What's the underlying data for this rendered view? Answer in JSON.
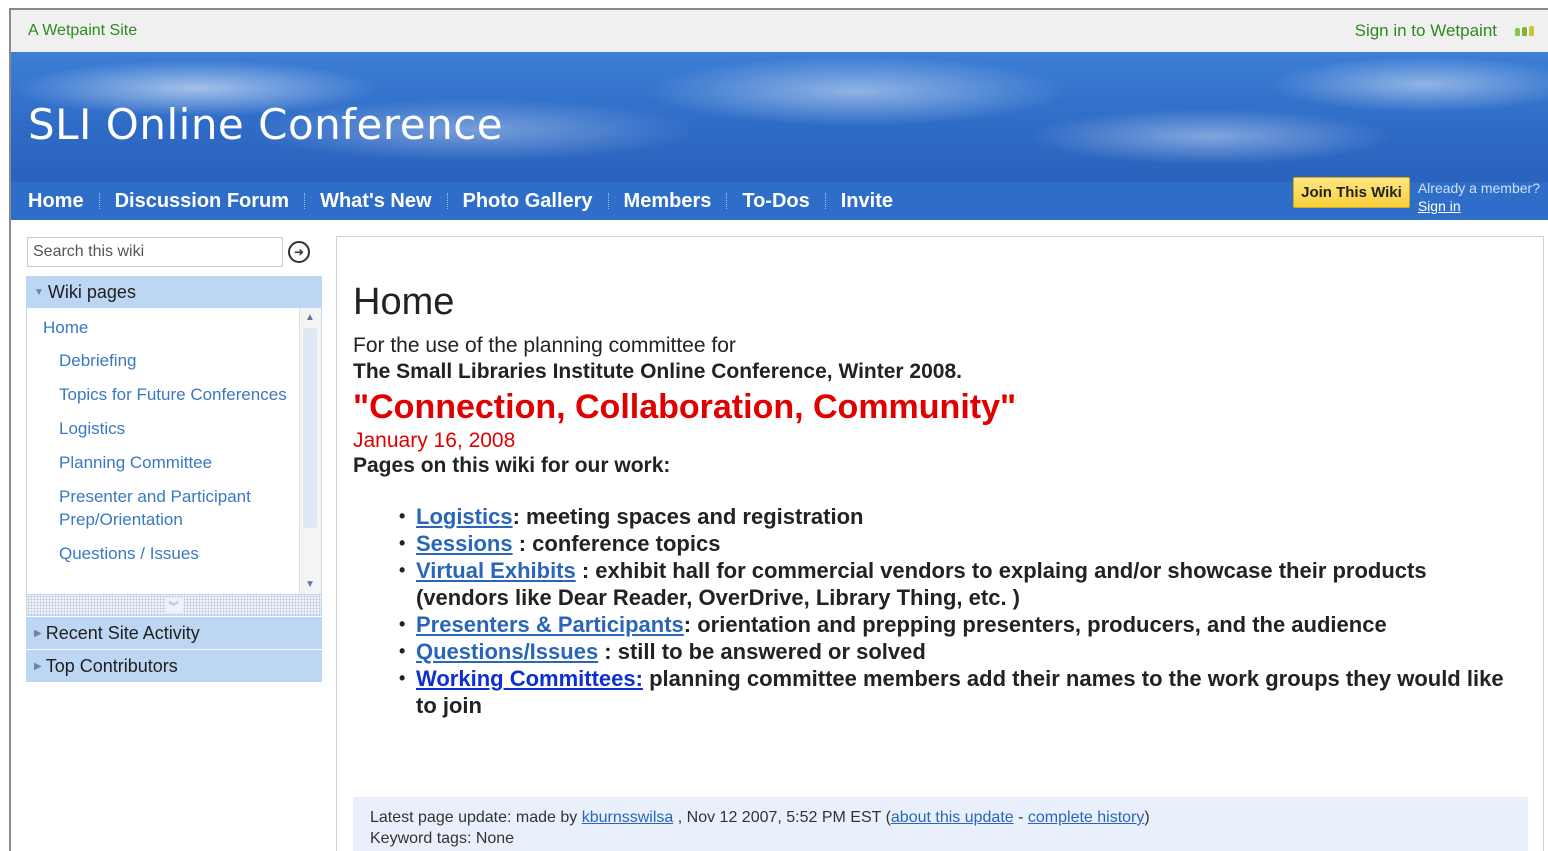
{
  "topbar": {
    "site_label": "A Wetpaint Site",
    "signin_label": "Sign in to Wetpaint",
    "logo_icon": "wetpaint-logo-icon"
  },
  "banner": {
    "title": "SLI Online Conference"
  },
  "nav": {
    "items": [
      "Home",
      "Discussion Forum",
      "What's New",
      "Photo Gallery",
      "Members",
      "To-Dos",
      "Invite"
    ],
    "join_label": "Join This Wiki",
    "already_member": "Already a member?",
    "sign_in": "Sign in"
  },
  "search": {
    "placeholder": "Search this wiki",
    "go_icon": "arrow-right-circle-icon"
  },
  "sidebar": {
    "wiki_pages_label": "Wiki pages",
    "pages": [
      {
        "label": "Home",
        "level": "top"
      },
      {
        "label": "Debriefing",
        "level": "sub"
      },
      {
        "label": "Topics for Future Conferences",
        "level": "sub"
      },
      {
        "label": "Logistics",
        "level": "sub"
      },
      {
        "label": "Planning Committee",
        "level": "sub"
      },
      {
        "label": "Presenter and Participant Prep/Orientation",
        "level": "sub"
      },
      {
        "label": "Questions / Issues",
        "level": "sub"
      }
    ],
    "recent_activity_label": "Recent Site Activity",
    "top_contributors_label": "Top Contributors"
  },
  "main": {
    "heading": "Home",
    "intro_line1": "For the use of the planning committee for",
    "intro_line2": "The Small Libraries Institute Online Conference, Winter 2008.",
    "slogan": "\"Connection, Collaboration, Community\"",
    "date": "January 16, 2008",
    "pages_heading": "Pages on this wiki for our work:",
    "bullets": [
      {
        "link": "Logistics",
        "text": ": meeting spaces and registration"
      },
      {
        "link": "Sessions",
        "text": " : conference topics"
      },
      {
        "link": "Virtual Exhibits",
        "text": " : exhibit hall for commercial vendors to explaing and/or showcase their products (vendors like Dear Reader, OverDrive, Library Thing, etc. )"
      },
      {
        "link": "Presenters & Participants",
        "text": ": orientation and prepping presenters, producers, and the audience"
      },
      {
        "link": "Questions/Issues",
        "text": " : still to be answered or solved"
      },
      {
        "link": "Working Committees:",
        "text": " planning committee members add their names to the work groups they would like to join"
      }
    ]
  },
  "footer": {
    "update_prefix": "Latest page update: made by ",
    "user": "kburnsswilsa",
    "update_time": " , Nov 12 2007, 5:52 PM EST (",
    "about_link": "about this update",
    "separator": " - ",
    "history_link": "complete history",
    "close_paren": ")",
    "keyword_tags": "Keyword tags: None"
  }
}
